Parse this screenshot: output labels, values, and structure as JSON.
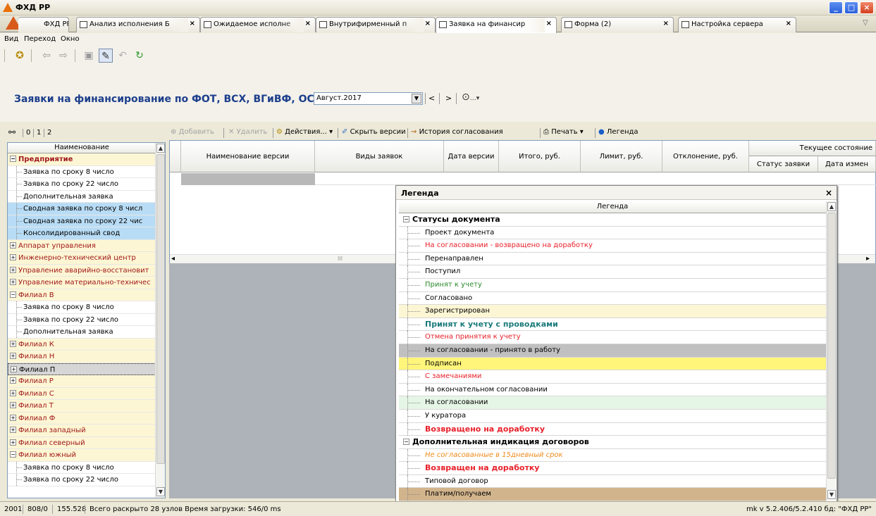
{
  "window": {
    "title": "ФХД РР"
  },
  "tabs": [
    {
      "label": "ФХД РР"
    },
    {
      "label": "Анализ исполнения Б"
    },
    {
      "label": "Ожидаемое исполне"
    },
    {
      "label": "Внутрифирменный п"
    },
    {
      "label": "Заявка на финансир"
    },
    {
      "label": "Форма (2)"
    },
    {
      "label": "Настройка сервера"
    }
  ],
  "menu": [
    "Вид",
    "Переход",
    "Окно"
  ],
  "header": {
    "title": "Заявки на финансирование по ФОТ, ВСХ, ВГиВФ, ОСНС",
    "period": "Август.2017",
    "prev": "<",
    "next": ">"
  },
  "tree_toolbar": {
    "levels": [
      "0",
      "1",
      "2"
    ]
  },
  "grid_toolbar": {
    "add": "Добавить",
    "delete": "Удалить",
    "actions": "Действия...",
    "hide_versions": "Скрыть версии",
    "history": "История согласования",
    "print": "Печать",
    "legend": "Легенда"
  },
  "tree": {
    "header": "Наименование",
    "rows": [
      {
        "label": "Предприятие",
        "type": "group-open",
        "bold": true
      },
      {
        "label": "Заявка по сроку 8 число",
        "type": "child"
      },
      {
        "label": "Заявка по сроку 22 число",
        "type": "child"
      },
      {
        "label": "Дополнительная заявка",
        "type": "child"
      },
      {
        "label": "Сводная заявка по сроку 8 числ",
        "type": "child-sel"
      },
      {
        "label": "Сводная заявка по сроку 22 чис",
        "type": "child-sel"
      },
      {
        "label": "Консолидированный свод",
        "type": "child-sel"
      },
      {
        "label": "Аппарат управления",
        "type": "group"
      },
      {
        "label": "Инженерно-технический центр",
        "type": "group"
      },
      {
        "label": "Управление аварийно-восстановит",
        "type": "group"
      },
      {
        "label": "Управление материально-техничес",
        "type": "group"
      },
      {
        "label": "Филиал В",
        "type": "group-open"
      },
      {
        "label": "Заявка по сроку 8 число",
        "type": "child"
      },
      {
        "label": "Заявка по сроку 22 число",
        "type": "child"
      },
      {
        "label": "Дополнительная заявка",
        "type": "child"
      },
      {
        "label": "Филиал К",
        "type": "group"
      },
      {
        "label": "Филиал Н",
        "type": "group"
      },
      {
        "label": "Филиал П",
        "type": "group-grey"
      },
      {
        "label": "Филиал Р",
        "type": "group"
      },
      {
        "label": "Филиал С",
        "type": "group"
      },
      {
        "label": "Филиал Т",
        "type": "group"
      },
      {
        "label": "Филиал Ф",
        "type": "group"
      },
      {
        "label": "Филиал западный",
        "type": "group"
      },
      {
        "label": "Филиал северный",
        "type": "group"
      },
      {
        "label": "Филиал южный",
        "type": "group-open"
      },
      {
        "label": "Заявка по сроку 8 число",
        "type": "child"
      },
      {
        "label": "Заявка по сроку 22 число",
        "type": "child"
      }
    ]
  },
  "grid": {
    "columns": [
      "Наименование версии",
      "Виды заявок",
      "Дата версии",
      "Итого, руб.",
      "Лимит, руб.",
      "Отклонение, руб."
    ],
    "group_header": "Текущее состояние",
    "sub_columns": [
      "Статус заявки",
      "Дата измен"
    ]
  },
  "legend": {
    "title": "Легенда",
    "close": "×",
    "header": "Легенда",
    "rows": [
      {
        "label": "Статусы документа",
        "kind": "group"
      },
      {
        "label": "Проект документа",
        "color": "#000000",
        "bg": "#ffffff"
      },
      {
        "label": "На согласовании - возвращено на доработку",
        "color": "#e8202a",
        "bg": "#ffffff"
      },
      {
        "label": "Перенаправлен",
        "color": "#000000",
        "bg": "#ffffff"
      },
      {
        "label": "Поступил",
        "color": "#000000",
        "bg": "#ffffff"
      },
      {
        "label": "Принят к учету",
        "color": "#2e8b2e",
        "bg": "#ffffff"
      },
      {
        "label": "Согласовано",
        "color": "#000000",
        "bg": "#ffffff"
      },
      {
        "label": "Зарегистрирован",
        "color": "#000000",
        "bg": "#fdf6d4"
      },
      {
        "label": "Принят к учету с проводками",
        "color": "#1a7a7a",
        "bg": "#ffffff",
        "bold": true
      },
      {
        "label": "Отмена принятия к учету",
        "color": "#e8202a",
        "bg": "#ffffff"
      },
      {
        "label": "На согласовании - принято в работу",
        "color": "#000000",
        "bg": "#c0c0c0"
      },
      {
        "label": "Подписан",
        "color": "#000000",
        "bg": "#fff57a"
      },
      {
        "label": "С замечаниями",
        "color": "#e8202a",
        "bg": "#ffffff"
      },
      {
        "label": "На окончательном согласовании",
        "color": "#000000",
        "bg": "#ffffff"
      },
      {
        "label": "На согласовании",
        "color": "#000000",
        "bg": "#e6f6e6"
      },
      {
        "label": "У куратора",
        "color": "#000000",
        "bg": "#ffffff"
      },
      {
        "label": "Возвращено на доработку",
        "color": "#e8202a",
        "bg": "#ffffff",
        "bold": true
      },
      {
        "label": "Дополнительная индикация договоров",
        "kind": "group"
      },
      {
        "label": "Не согласованные в 15дневный срок",
        "color": "#f08a1a",
        "bg": "#ffffff",
        "italic": true
      },
      {
        "label": "Возвращен на доработку",
        "color": "#e8202a",
        "bg": "#ffffff",
        "bold": true
      },
      {
        "label": "Типовой договор",
        "color": "#000000",
        "bg": "#ffffff"
      },
      {
        "label": "Платим/получаем",
        "color": "#000000",
        "bg": "#d2b48c"
      }
    ]
  },
  "status": {
    "s1": "2001",
    "s2": "808/0",
    "s3": "155.528",
    "s4": "Всего раскрыто 28 узлов  Время загрузки: 546/0 ms",
    "right": "mk  v 5.2.406/5.2.410  бд: \"ФХД РР\""
  }
}
